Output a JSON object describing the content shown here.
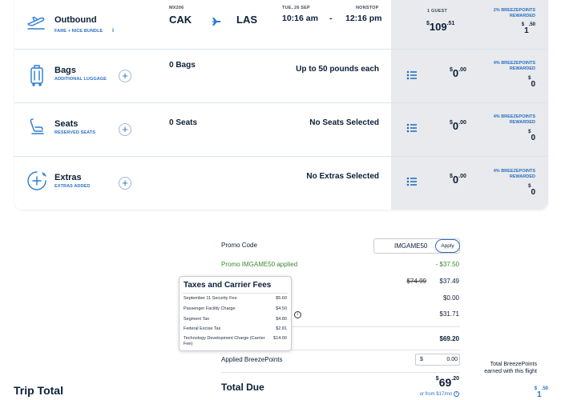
{
  "outbound": {
    "title": "Outbound",
    "subtitle": "FARE + NICE BUNDLE",
    "info_icon": "i",
    "flight_number": "MX206",
    "origin": "CAK",
    "destination": "LAS",
    "date": "TUE, 26 SEP",
    "depart_time": "10:16 am",
    "dash": "-",
    "stops": "NONSTOP",
    "arrive_time": "12:16 pm",
    "guests": "1 GUEST",
    "price_currency": "$",
    "price_whole": "109",
    "price_cents": ".51",
    "points_label_1": "2% BREEZEPOINTS",
    "points_label_2": "REWARDED",
    "points_currency": "$",
    "points_whole": "1",
    "points_cents": ".50"
  },
  "bags": {
    "title": "Bags",
    "subtitle": "ADDITIONAL LUGGAGE",
    "count": "0 Bags",
    "detail": "Up to 50 pounds each",
    "price_currency": "$",
    "price_whole": "0",
    "price_cents": ".00",
    "points_label_1": "4% BREEZEPOINTS",
    "points_label_2": "REWARDED",
    "points_currency": "$",
    "points_whole": "0"
  },
  "seats": {
    "title": "Seats",
    "subtitle": "RESERVED SEATS",
    "count": "0 Seats",
    "detail": "No Seats Selected",
    "price_currency": "$",
    "price_whole": "0",
    "price_cents": ".00",
    "points_label_1": "4% BREEZEPOINTS",
    "points_label_2": "REWARDED",
    "points_currency": "$",
    "points_whole": "0"
  },
  "extras": {
    "title": "Extras",
    "subtitle": "EXTRAS ADDED",
    "detail": "No Extras Selected",
    "price_currency": "$",
    "price_whole": "0",
    "price_cents": ".00",
    "points_label_1": "4% BREEZEPOINTS",
    "points_label_2": "REWARDED",
    "points_currency": "$",
    "points_whole": "0"
  },
  "summary": {
    "promo_label": "Promo Code",
    "promo_value": "IMGAME50",
    "apply_label": "Apply",
    "promo_applied": "Promo IMGAME50 applied",
    "promo_discount": "- $37.50",
    "fare_original": "$74.99",
    "fare_discounted": "$37.49",
    "line_zero": "$0.00",
    "taxes_value": "$31.71",
    "subtotal_value": "$69.20",
    "breezepoints_label": "Applied BreezePoints",
    "breezepoints_currency": "$",
    "breezepoints_value": "0.00",
    "total_points_label_1": "Total BreezePoints",
    "total_points_label_2": "earned with this flight",
    "total_points_currency": "$",
    "total_points_whole": "1",
    "total_points_cents": ".50",
    "trip_total_label": "Trip Total",
    "total_due_label": "Total Due",
    "total_currency": "$",
    "total_whole": "69",
    "total_cents": ".20",
    "monthly": "or from $17/mo"
  },
  "tooltip": {
    "title": "Taxes and Carrier Fees",
    "rows": [
      {
        "label": "September 11 Security Fee",
        "value": "$5.60"
      },
      {
        "label": "Passenger Facility Charge",
        "value": "$4.50"
      },
      {
        "label": "Segment Tax",
        "value": "$4.80"
      },
      {
        "label": "Federal Excise Tax",
        "value": "$2.81"
      },
      {
        "label": "Technology Development Charge (Carrier Fee)",
        "value": "$14.00"
      }
    ]
  },
  "colors": {
    "accent": "#2b6fc2",
    "navy": "#0b1f36",
    "green": "#3c8a2e",
    "gray_panel": "#e8eaed"
  }
}
